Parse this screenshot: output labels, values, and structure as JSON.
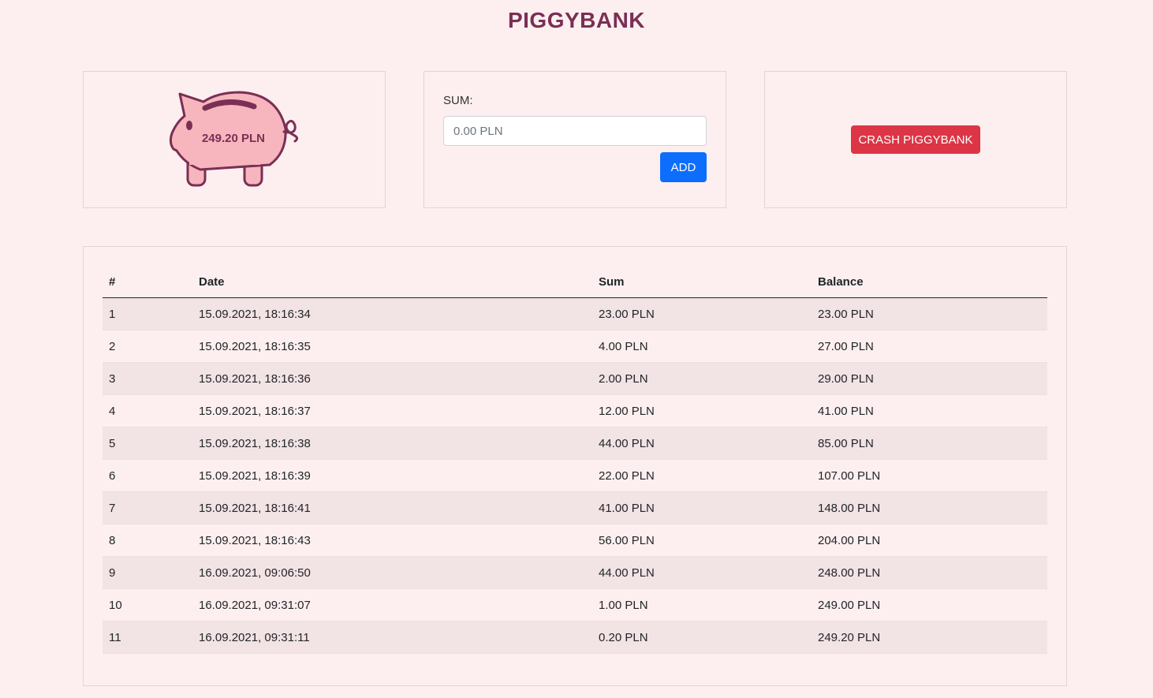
{
  "app": {
    "title": "PIGGYBANK"
  },
  "piggy": {
    "balance": "249.20 PLN",
    "icon": "piggy-bank-icon",
    "fill_color": "#f7b5bd",
    "stroke_color": "#7a2f55"
  },
  "deposit": {
    "label": "SUM:",
    "placeholder": "0.00 PLN",
    "value": "",
    "add_label": "ADD"
  },
  "crash": {
    "label": "CRASH PIGGYBANK"
  },
  "colors": {
    "add_button": "#0d6efd",
    "crash_button": "#dc3545",
    "title": "#7a2f55",
    "background": "#fdefef"
  },
  "table": {
    "headers": [
      "#",
      "Date",
      "Sum",
      "Balance"
    ],
    "rows": [
      [
        "1",
        "15.09.2021, 18:16:34",
        "23.00 PLN",
        "23.00 PLN"
      ],
      [
        "2",
        "15.09.2021, 18:16:35",
        "4.00 PLN",
        "27.00 PLN"
      ],
      [
        "3",
        "15.09.2021, 18:16:36",
        "2.00 PLN",
        "29.00 PLN"
      ],
      [
        "4",
        "15.09.2021, 18:16:37",
        "12.00 PLN",
        "41.00 PLN"
      ],
      [
        "5",
        "15.09.2021, 18:16:38",
        "44.00 PLN",
        "85.00 PLN"
      ],
      [
        "6",
        "15.09.2021, 18:16:39",
        "22.00 PLN",
        "107.00 PLN"
      ],
      [
        "7",
        "15.09.2021, 18:16:41",
        "41.00 PLN",
        "148.00 PLN"
      ],
      [
        "8",
        "15.09.2021, 18:16:43",
        "56.00 PLN",
        "204.00 PLN"
      ],
      [
        "9",
        "16.09.2021, 09:06:50",
        "44.00 PLN",
        "248.00 PLN"
      ],
      [
        "10",
        "16.09.2021, 09:31:07",
        "1.00 PLN",
        "249.00 PLN"
      ],
      [
        "11",
        "16.09.2021, 09:31:11",
        "0.20 PLN",
        "249.20 PLN"
      ]
    ]
  }
}
